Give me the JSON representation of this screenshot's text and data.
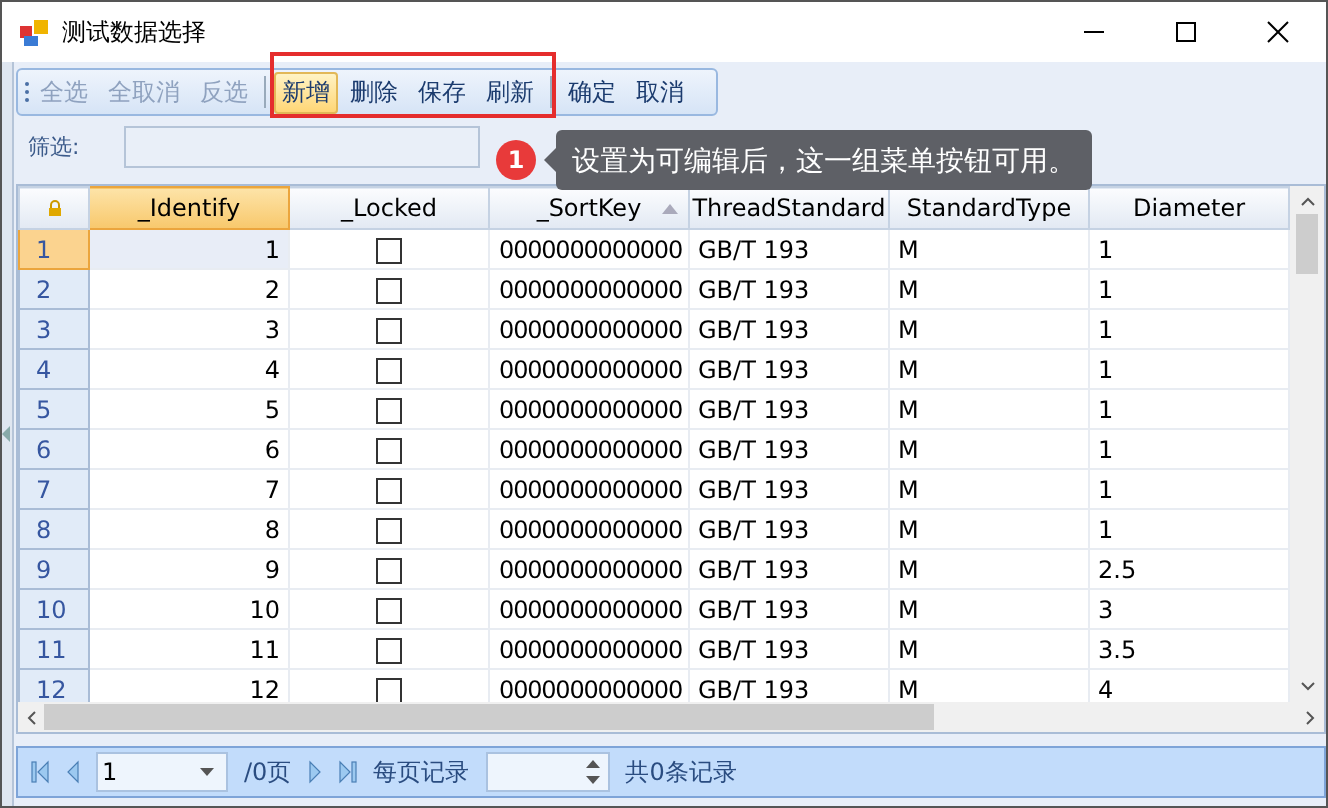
{
  "window": {
    "title": "测试数据选择"
  },
  "toolbar": [
    {
      "label": "全选",
      "disabled": true,
      "highlighted": false
    },
    {
      "label": "全取消",
      "disabled": true,
      "highlighted": false
    },
    {
      "label": "反选",
      "disabled": true,
      "highlighted": false
    },
    {
      "label": "新增",
      "disabled": false,
      "highlighted": true
    },
    {
      "label": "删除",
      "disabled": false,
      "highlighted": false
    },
    {
      "label": "保存",
      "disabled": false,
      "highlighted": false
    },
    {
      "label": "刷新",
      "disabled": false,
      "highlighted": false
    },
    {
      "label": "确定",
      "disabled": false,
      "highlighted": false
    },
    {
      "label": "取消",
      "disabled": false,
      "highlighted": false
    }
  ],
  "filter": {
    "label": "筛选:"
  },
  "callout": {
    "number": "1",
    "text": "设置为可编辑后，这一组菜单按钮可用。"
  },
  "table": {
    "columns": [
      "_Identify",
      "_Locked",
      "_SortKey",
      "ThreadStandard",
      "StandardType",
      "Diameter"
    ],
    "rows": [
      {
        "header": "1",
        "selected": true,
        "identify": "1",
        "locked": false,
        "sortkey": "0000000000000",
        "thread": "GB/T 193",
        "type": "M",
        "diameter": "1"
      },
      {
        "header": "2",
        "selected": false,
        "identify": "2",
        "locked": false,
        "sortkey": "0000000000000",
        "thread": "GB/T 193",
        "type": "M",
        "diameter": "1"
      },
      {
        "header": "3",
        "selected": false,
        "identify": "3",
        "locked": false,
        "sortkey": "0000000000000",
        "thread": "GB/T 193",
        "type": "M",
        "diameter": "1"
      },
      {
        "header": "4",
        "selected": false,
        "identify": "4",
        "locked": false,
        "sortkey": "0000000000000",
        "thread": "GB/T 193",
        "type": "M",
        "diameter": "1"
      },
      {
        "header": "5",
        "selected": false,
        "identify": "5",
        "locked": false,
        "sortkey": "0000000000000",
        "thread": "GB/T 193",
        "type": "M",
        "diameter": "1"
      },
      {
        "header": "6",
        "selected": false,
        "identify": "6",
        "locked": false,
        "sortkey": "0000000000000",
        "thread": "GB/T 193",
        "type": "M",
        "diameter": "1"
      },
      {
        "header": "7",
        "selected": false,
        "identify": "7",
        "locked": false,
        "sortkey": "0000000000000",
        "thread": "GB/T 193",
        "type": "M",
        "diameter": "1"
      },
      {
        "header": "8",
        "selected": false,
        "identify": "8",
        "locked": false,
        "sortkey": "0000000000000",
        "thread": "GB/T 193",
        "type": "M",
        "diameter": "1"
      },
      {
        "header": "9",
        "selected": false,
        "identify": "9",
        "locked": false,
        "sortkey": "0000000000000",
        "thread": "GB/T 193",
        "type": "M",
        "diameter": "2.5"
      },
      {
        "header": "10",
        "selected": false,
        "identify": "10",
        "locked": false,
        "sortkey": "0000000000000",
        "thread": "GB/T 193",
        "type": "M",
        "diameter": "3"
      },
      {
        "header": "11",
        "selected": false,
        "identify": "11",
        "locked": false,
        "sortkey": "0000000000000",
        "thread": "GB/T 193",
        "type": "M",
        "diameter": "3.5"
      },
      {
        "header": "12",
        "selected": false,
        "identify": "12",
        "locked": false,
        "sortkey": "0000000000000",
        "thread": "GB/T 193",
        "type": "M",
        "diameter": "4"
      }
    ]
  },
  "pager": {
    "page": "1",
    "pages_label": "/0页",
    "per_page_label": "每页记录",
    "total_label": "共0条记录"
  }
}
